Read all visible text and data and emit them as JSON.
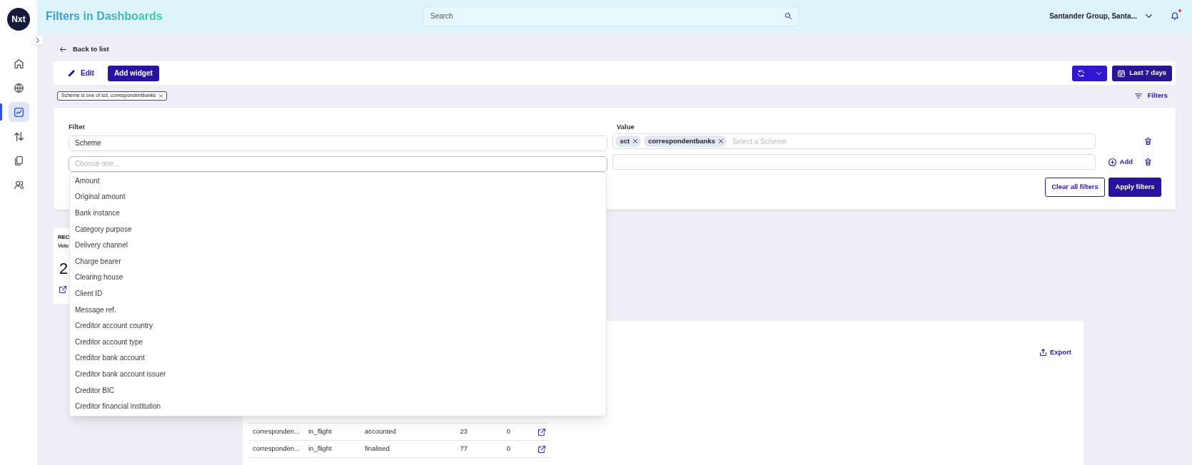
{
  "sidebar": {
    "logo": "Nxt",
    "items": [
      {
        "kind": "home",
        "selected": false
      },
      {
        "kind": "globe",
        "selected": false
      },
      {
        "kind": "chart",
        "selected": true
      },
      {
        "kind": "transfers",
        "selected": false
      },
      {
        "kind": "documents",
        "selected": false
      },
      {
        "kind": "users",
        "selected": false
      }
    ]
  },
  "header": {
    "title": "Filters in Dashboards",
    "search": {
      "placeholder": "Search"
    },
    "organization": "Santander Group, Santa...",
    "notifications": {
      "unread": true
    }
  },
  "back_link": "Back to list",
  "toolbar": {
    "edit": "Edit",
    "add_widget": "Add widget",
    "date_range": "Last 7 days"
  },
  "active_filters": [
    "Scheme is one of sct, correspondentbanks"
  ],
  "filters_toggle": "Filters",
  "filter_panel": {
    "filter_label": "Filter",
    "value_label": "Value",
    "rows": [
      {
        "filter_value": "Scheme",
        "expanded": false,
        "tags": [
          "sct",
          "correspondentbanks"
        ],
        "value_placeholder": "Select a Scheme"
      },
      {
        "filter_placeholder": "Choose one...",
        "expanded": true,
        "add_label": "Add",
        "options": [
          "Amount",
          "Original amount",
          "Bank instance",
          "Category purpose",
          "Delivery channel",
          "Charge bearer",
          "Clearing house",
          "Client ID",
          "Message ref.",
          "Creditor account country",
          "Creditor account type",
          "Creditor bank account",
          "Creditor bank account issuer",
          "Creditor BIC",
          "Creditor financial institution"
        ]
      }
    ],
    "clear_button": "Clear all filters",
    "apply_button": "Apply filters"
  },
  "widgets": [
    {
      "kind": "kpi",
      "title": "REC",
      "subtitle": "Volu",
      "value": "2"
    },
    {
      "kind": "table",
      "export_label": "Export",
      "rows": [
        {
          "cells": [
            "corresponden...",
            "in_flight",
            "accounted",
            "23",
            "0"
          ]
        },
        {
          "cells": [
            "corresponden...",
            "in_flight",
            "finalised",
            "77",
            "0"
          ]
        }
      ]
    }
  ]
}
